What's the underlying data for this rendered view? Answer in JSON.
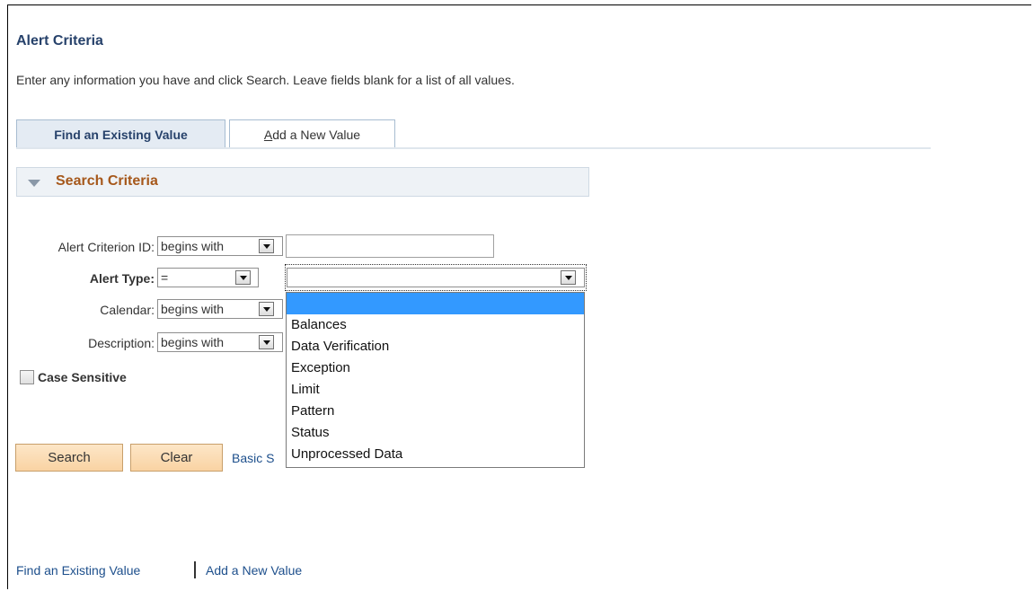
{
  "page": {
    "title": "Alert Criteria",
    "instructions": "Enter any information you have and click Search. Leave fields blank for a list of all values."
  },
  "tabs": [
    {
      "label": "Find an Existing Value",
      "active": true
    },
    {
      "label_first": "A",
      "label_rest": "dd a New Value",
      "active": false
    }
  ],
  "section": {
    "title": "Search Criteria",
    "icon": "collapse-triangle-icon"
  },
  "form": {
    "alert_criterion_id": {
      "label": "Alert Criterion ID:",
      "operator": "begins with",
      "value": ""
    },
    "alert_type": {
      "label": "Alert Type:",
      "operator": "=",
      "value": ""
    },
    "calendar": {
      "label": "Calendar:",
      "operator": "begins with"
    },
    "description": {
      "label": "Description:",
      "operator": "begins with"
    },
    "case_sensitive": {
      "label": "Case Sensitive",
      "checked": false
    }
  },
  "buttons": {
    "search": "Search",
    "clear": "Clear",
    "basic_search_visible": "Basic S"
  },
  "alert_type_options": [
    "",
    "Balances",
    "Data Verification",
    "Exception",
    "Limit",
    "Pattern",
    "Status",
    "Unprocessed Data"
  ],
  "footer": {
    "find_link": "Find an Existing Value",
    "add_link": "Add a New Value"
  },
  "colors": {
    "title": "#27426b",
    "section_title": "#a6581b",
    "link": "#1d4f8c",
    "selected_option": "#3399ff",
    "button": "#f9d3a3"
  }
}
